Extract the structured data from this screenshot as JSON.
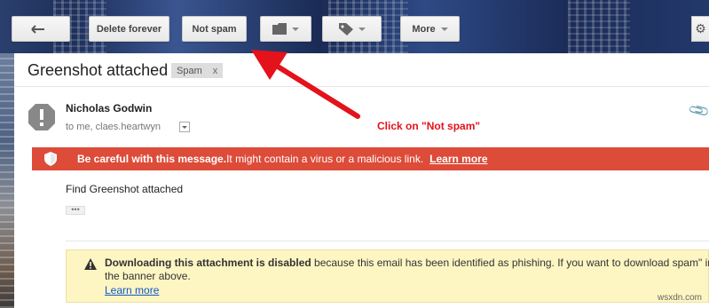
{
  "toolbar": {
    "back_label": "",
    "delete_forever_label": "Delete forever",
    "not_spam_label": "Not spam",
    "move_icon": "folder-icon",
    "labels_icon": "tag-icon",
    "more_label": "More"
  },
  "email": {
    "subject": "Greenshot attached",
    "label": "Spam",
    "label_remove": "x",
    "sender_name": "Nicholas Godwin",
    "recipient": "to me, claes.heartwyn",
    "body": "Find Greenshot attached",
    "ellipsis": "•••"
  },
  "phishing_banner": {
    "bold_text": "Be careful with this message.",
    "text": " It might contain a virus or a malicious link.",
    "link": "Learn more",
    "color": "#dd4b39"
  },
  "attachment_warning": {
    "bold_text": "Downloading this attachment is disabled",
    "text": " because this email has been identified as phishing. If you want to download spam\" in the banner above.",
    "link": "Learn more",
    "color": "#fdf6c3"
  },
  "annotation": {
    "text": "Click on \"Not spam\"",
    "color": "#e3121b"
  },
  "watermark": "wsxdn.com"
}
